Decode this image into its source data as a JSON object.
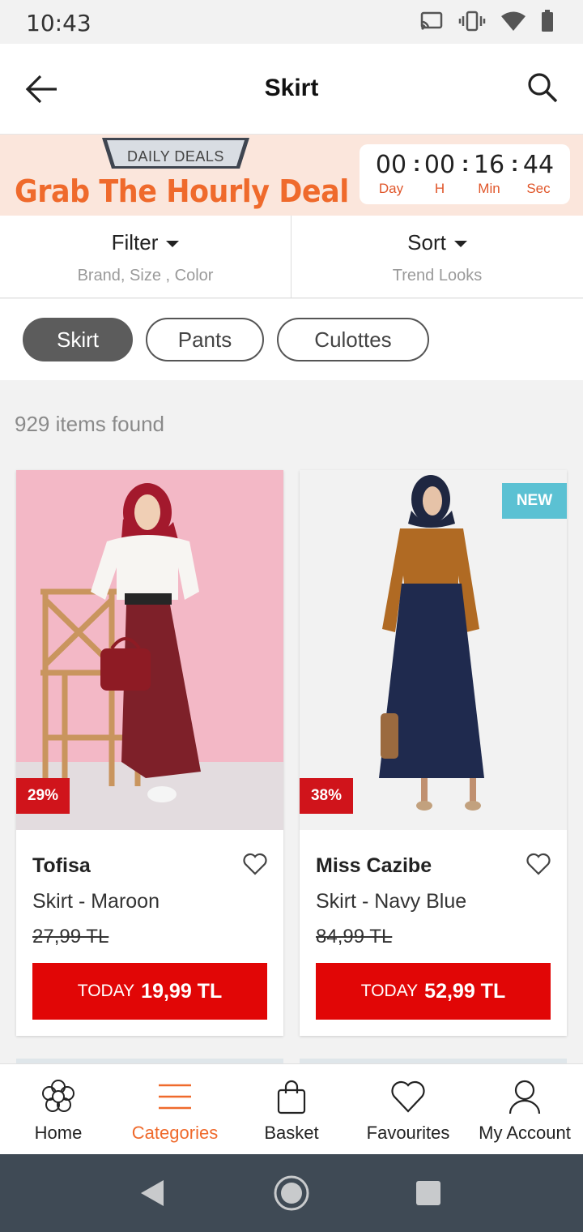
{
  "status": {
    "time": "10:43"
  },
  "header": {
    "title": "Skirt"
  },
  "deal": {
    "tag": "DAILY DEALS",
    "headline": "Grab The Hourly Deal",
    "timer": [
      {
        "value": "00",
        "label": "Day"
      },
      {
        "value": "00",
        "label": "H"
      },
      {
        "value": "16",
        "label": "Min"
      },
      {
        "value": "44",
        "label": "Sec"
      }
    ]
  },
  "filter": {
    "label": "Filter",
    "sub": "Brand, Size , Color"
  },
  "sort": {
    "label": "Sort",
    "sub": "Trend Looks"
  },
  "chips": [
    "Skirt",
    "Pants",
    "Culottes"
  ],
  "results": {
    "count": "929 items found"
  },
  "products": [
    {
      "brand": "Tofisa",
      "name": "Skirt - Maroon",
      "old_price": "27,99 TL",
      "today_label": "TODAY",
      "price": "19,99 TL",
      "discount": "29%",
      "badge": ""
    },
    {
      "brand": "Miss Cazibe",
      "name": "Skirt - Navy Blue",
      "old_price": "84,99 TL",
      "today_label": "TODAY",
      "price": "52,99 TL",
      "discount": "38%",
      "badge": "NEW"
    }
  ],
  "tabs": [
    {
      "label": "Home",
      "icon": "flower-icon"
    },
    {
      "label": "Categories",
      "icon": "menu-lines-icon"
    },
    {
      "label": "Basket",
      "icon": "shopping-bag-icon"
    },
    {
      "label": "Favourites",
      "icon": "heart-icon"
    },
    {
      "label": "My Account",
      "icon": "user-icon"
    }
  ],
  "colors": {
    "accent": "#ef6a2c",
    "buy": "#e10606",
    "discount": "#d0141b",
    "new_badge": "#5bc1d3"
  }
}
